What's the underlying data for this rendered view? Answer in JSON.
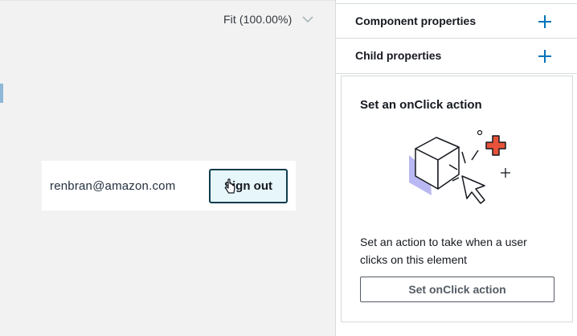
{
  "canvas": {
    "zoom_label": "Fit (100.00%)",
    "zoom_icon": "chevron-down-icon",
    "preview": {
      "email": "renbran@amazon.com",
      "signout_label": "Sign out"
    },
    "cursor_icon": "pointer-cursor-icon"
  },
  "panel": {
    "rows": [
      {
        "label": "Component properties",
        "icon": "plus-icon"
      },
      {
        "label": "Child properties",
        "icon": "plus-icon"
      }
    ],
    "action": {
      "title": "Set an onClick action",
      "illustration": "cube-click-illustration",
      "description": "Set an action to take when a user clicks on this element",
      "button_label": "Set onClick action"
    }
  },
  "colors": {
    "accent": "#0073bb",
    "button_border": "#0f3d4d",
    "button_bg": "#e6f6fb",
    "illustration_red": "#e8523a",
    "illustration_lavender": "#b9b8f2"
  }
}
